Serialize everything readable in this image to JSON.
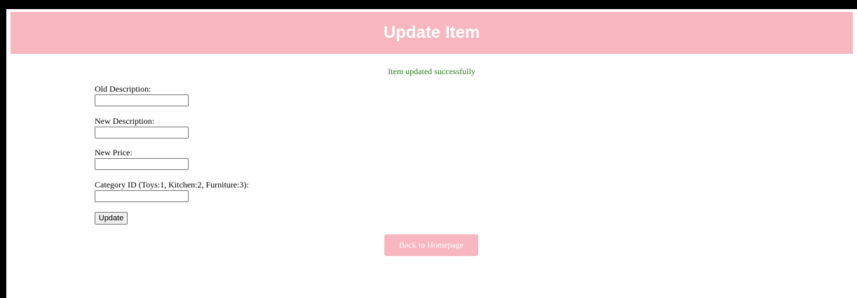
{
  "header": {
    "title": "Update Item"
  },
  "status": {
    "message": "Item updated successfully"
  },
  "form": {
    "fields": [
      {
        "label": "Old Description:",
        "value": ""
      },
      {
        "label": "New Description:",
        "value": ""
      },
      {
        "label": "New Price:",
        "value": ""
      },
      {
        "label": "Category ID (Toys:1, Kitchen:2, Furniture:3):",
        "value": ""
      }
    ],
    "submit_label": "Update"
  },
  "navigation": {
    "back_label": "Back to Homepage"
  },
  "colors": {
    "header_background": "#f7b6c0",
    "success_text": "#2e7d1e",
    "back_button_background": "#f7b6c0"
  }
}
